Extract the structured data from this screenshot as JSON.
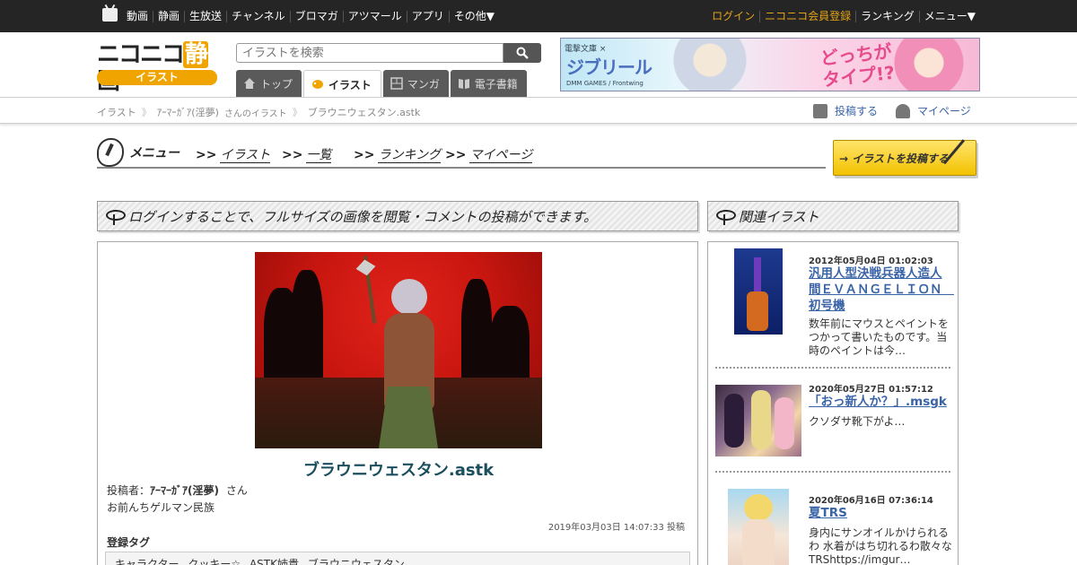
{
  "topbar": {
    "nav_left": [
      "動画",
      "静画",
      "生放送",
      "チャンネル",
      "ブロマガ",
      "アツマール",
      "アプリ",
      "その他▼"
    ],
    "nav_right": [
      "ログイン",
      "ニコニコ会員登録",
      "ランキング",
      "メニュー▼"
    ]
  },
  "header": {
    "logo_text": "ニコニコ",
    "logo_sei": "静",
    "logo_ga": "画",
    "logo_badge": "イラスト",
    "search_placeholder": "イラストを検索",
    "tabs": [
      {
        "label": "トップ",
        "active": false
      },
      {
        "label": "イラスト",
        "active": true
      },
      {
        "label": "マンガ",
        "active": false
      },
      {
        "label": "電子書籍",
        "active": false
      }
    ],
    "banner": {
      "top_text": "電撃文庫 × ",
      "main_text": "ジブリール",
      "sub_text": "DMM GAMES / Frontwing",
      "catch_text": "どっちが\nタイプ!?"
    }
  },
  "breadcrumb": {
    "items": [
      "イラスト",
      "ｱｰﾏｰｶﾞｱ(淫夢)",
      "さんのイラスト",
      "ブラウニウェスタン.astk"
    ],
    "post_label": "投稿する",
    "mypage_label": "マイページ"
  },
  "menu": {
    "label": "メニュー",
    "items": [
      "イラスト",
      "一覧",
      "ランキング",
      "マイページ"
    ],
    "arrow": ">>",
    "post_button": "→ イラストを投稿する"
  },
  "login_notice": "ログインすることで、フルサイズの画像を閲覧・コメントの投稿ができます。",
  "related_heading": "関連イラスト",
  "artwork": {
    "title": "ブラウニウェスタン.astk",
    "author_prefix": "投稿者：",
    "author": "ｱｰﾏｰｶﾞｱ(淫夢)",
    "author_suffix": "さん",
    "description": "お前んちゲルマン民族",
    "posted": "2019年03月03日 14:07:33 投稿",
    "tags_label": "登録タグ",
    "tags": [
      "キャラクター",
      "クッキー☆",
      "ASTK姉貴",
      "ブラウニウェスタン"
    ]
  },
  "related": [
    {
      "date": "2012年05月04日 01:02:03",
      "title": "汎用人型決戦兵器人造人間ＥＶＡＮＧＥＬＩＯＮ　初号機",
      "desc": "数年前にマウスとペイントをつかって書いたものです。当時のペイントは今…"
    },
    {
      "date": "2020年05月27日 01:57:12",
      "title": "「おっ新人か？」.msgk",
      "desc": "クソダサ靴下がよ…"
    },
    {
      "date": "2020年06月16日 07:36:14",
      "title": "夏TRS",
      "desc": "身内にサンオイルかけられるわ 水着がはち切れるわ散々なTRShttps://imgur…"
    }
  ],
  "colors": {
    "topbar_bg": "#252525",
    "accent_orange": "#f0a400",
    "link_blue": "#3a64a8",
    "title_teal": "#1b4f5e"
  }
}
